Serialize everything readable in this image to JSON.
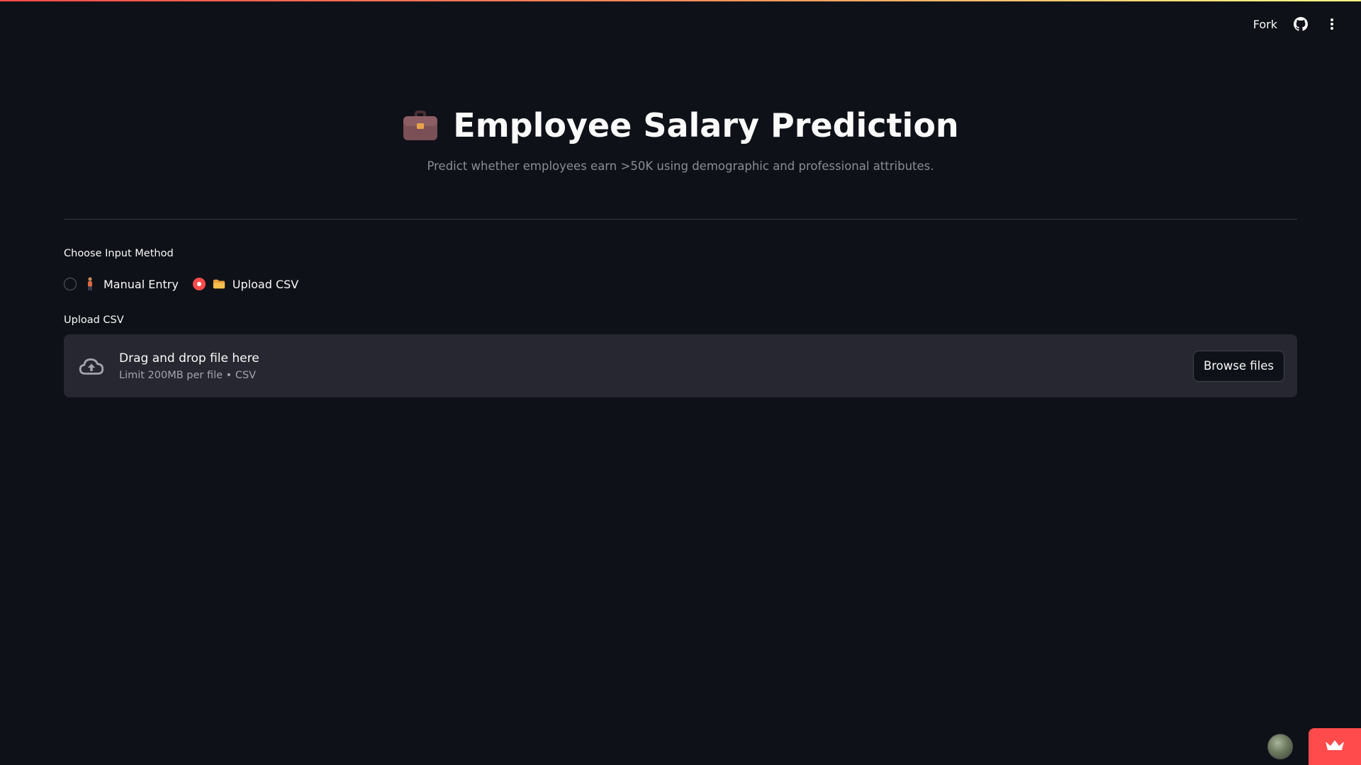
{
  "toolbar": {
    "fork_label": "Fork",
    "icons": [
      "github-icon",
      "more-vert-icon"
    ]
  },
  "header": {
    "title": "Employee Salary Prediction",
    "title_icon": "briefcase-icon",
    "subtitle": "Predict whether employees earn >50K using demographic and professional attributes."
  },
  "input_method": {
    "label": "Choose Input Method",
    "options": [
      {
        "label": "Manual Entry",
        "icon": "person-icon",
        "selected": false
      },
      {
        "label": "Upload CSV",
        "icon": "folder-icon",
        "selected": true
      }
    ]
  },
  "uploader": {
    "label": "Upload CSV",
    "title": "Drag and drop file here",
    "hint": "Limit 200MB per file • CSV",
    "button_label": "Browse files",
    "icon": "cloud-upload-icon"
  },
  "footer": {
    "avatar": "avatar",
    "badge_icon": "crown-icon"
  },
  "colors": {
    "background": "#0e1117",
    "accent": "#ff4b4b",
    "dropzone": "#262730",
    "muted_text": "#8b8d95"
  }
}
